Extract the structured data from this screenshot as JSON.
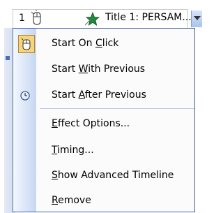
{
  "combo": {
    "index": "1",
    "title": "Title 1: PERSAM..."
  },
  "menu": {
    "items": [
      {
        "pre": "Start On ",
        "u": "C",
        "post": "lick",
        "icon": "mouse-click-icon",
        "selected": true
      },
      {
        "pre": "Start ",
        "u": "W",
        "post": "ith Previous",
        "icon": "",
        "selected": false
      },
      {
        "pre": "Start ",
        "u": "A",
        "post": "fter Previous",
        "icon": "clock-icon",
        "selected": false
      },
      {
        "pre": "",
        "u": "E",
        "post": "ffect Options...",
        "icon": "",
        "selected": false
      },
      {
        "pre": "",
        "u": "T",
        "post": "iming...",
        "icon": "",
        "selected": false
      },
      {
        "pre": "",
        "u": "S",
        "post": "how Advanced Timeline",
        "icon": "",
        "selected": false
      },
      {
        "pre": "",
        "u": "R",
        "post": "emove",
        "icon": "",
        "selected": false
      }
    ]
  },
  "colors": {
    "accent": "#4a6aa6",
    "selection_fill": "#f7d57a",
    "selection_border": "#b3833b"
  }
}
